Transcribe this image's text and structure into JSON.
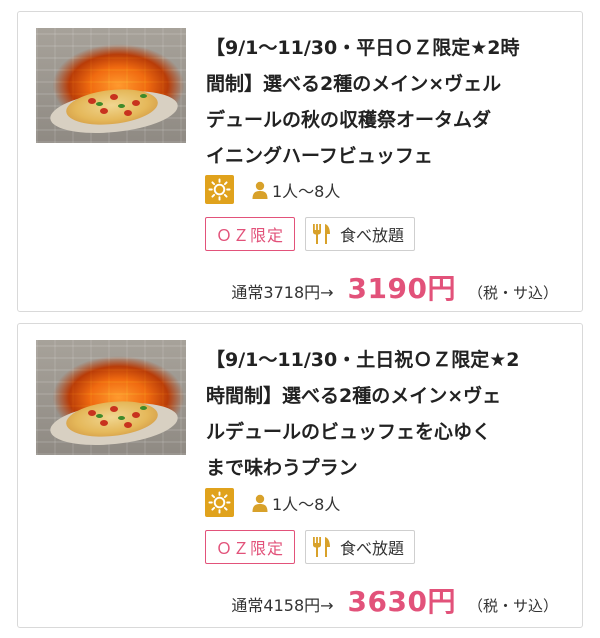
{
  "plans": [
    {
      "title_lines": [
        "【9/1〜11/30・平日ＯＺ限定★2時",
        "間制】選べる2種のメイン×ヴェル",
        "デュールの秋の収穫祭オータムダ",
        "イニングハーフビュッフェ"
      ],
      "time_icon": "sun-icon",
      "capacity": "1人〜8人",
      "tags": [
        "ＯＺ限定",
        "食べ放題"
      ],
      "regular_price": "通常3718円→",
      "sale_price": "3190円",
      "tax_note": "（税・サ込）"
    },
    {
      "title_lines": [
        "【9/1〜11/30・土日祝ＯＺ限定★2",
        "時間制】選べる2種のメイン×ヴェ",
        "ルデュールのビュッフェを心ゆく",
        "まで味わうプラン"
      ],
      "time_icon": "sun-icon",
      "capacity": "1人〜8人",
      "tags": [
        "ＯＺ限定",
        "食べ放題"
      ],
      "regular_price": "通常4158円→",
      "sale_price": "3630円",
      "tax_note": "（税・サ込）"
    }
  ],
  "colors": {
    "accent_pink": "#e2527a",
    "sun_badge": "#e0a21c",
    "person_icon": "#d8a12a",
    "border": "#d9d9d9"
  }
}
